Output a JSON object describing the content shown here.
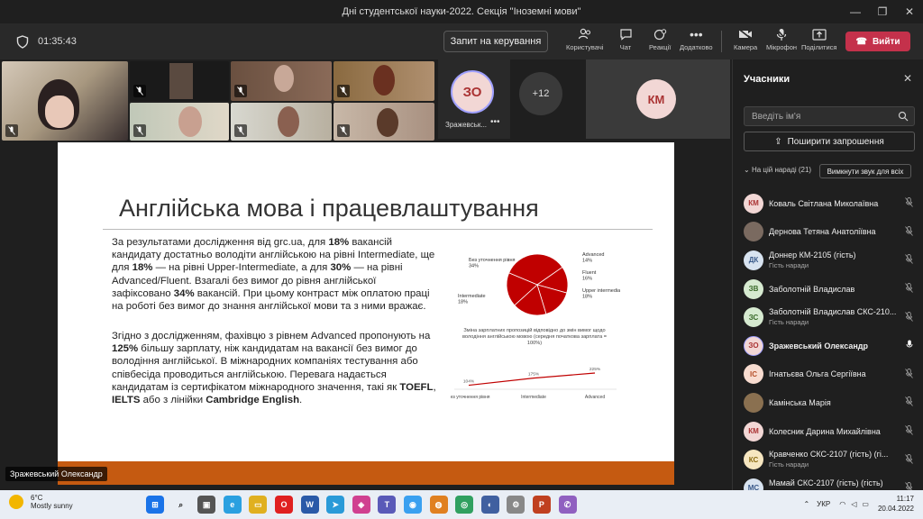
{
  "window": {
    "title": "Дні студентської науки-2022. Секція \"Іноземні мови\"",
    "controls": [
      "—",
      "❐",
      "✕"
    ]
  },
  "toolbar": {
    "timer": "01:35:43",
    "request_control": "Запит на керування",
    "buttons": [
      {
        "label": "Користувачі",
        "icon": "people-icon",
        "badge": "21"
      },
      {
        "label": "Чат",
        "icon": "chat-icon"
      },
      {
        "label": "Реакції",
        "icon": "reactions-icon"
      },
      {
        "label": "Додатково",
        "icon": "more-icon"
      },
      {
        "label": "Камера",
        "icon": "camera-off-icon"
      },
      {
        "label": "Мікрофон",
        "icon": "mic-off-icon"
      },
      {
        "label": "Поділитися",
        "icon": "share-icon"
      }
    ],
    "leave": "Вийти"
  },
  "videos": {
    "avatar_initials": "ЗО",
    "avatar_name": "Зражевськ...",
    "more_count": "+12",
    "km_initials": "КМ"
  },
  "slide": {
    "title": "Англійська мова і працевлаштування",
    "para1": "За результатами дослідження від grc.ua, для 18% вакансій кандидату достатньо володіти англійською на рівні Intermediate, ще для 18% — на рівні Upper-Intermediate, а для 30% — на рівні Advanced/Fluent. Взагалі без вимог до рівня англійської зафіксовано 34% вакансій. При цьому контраст між оплатою праці на роботі без вимог до знання англійської мови та з ними вражає.",
    "para2": "Згідно з дослідженням, фахівцю з рівнем Advanced пропонують на 125% більшу зарплату, ніж кандидатам на вакансії без вимог до володіння англійської. В міжнародних компаніях тестування або співбесіда проводиться англійською. Перевага надається кандидатам із сертифікатом міжнародного значення, такі як TOEFL, IELTS або з лінійки Cambridge English.",
    "line_chart_title": "Зміна зарплатних пропозицій відповідно до змін вимог щодо володіння англійською мовою (середня початкова зарплата = 100%)",
    "presenter_label": "Зражевський Олександр"
  },
  "chart_data": [
    {
      "type": "pie",
      "categories": [
        "Без уточнення рівня",
        "Advanced",
        "Fluent",
        "Upper intermediate",
        "Intermediate"
      ],
      "values": [
        34,
        14,
        16,
        18,
        18
      ],
      "labels": [
        "Без уточнення рівня\n34%",
        "Advanced\n14%",
        "Fluent\n16%",
        "Upper intermediate\n18%",
        "Intermediate\n18%"
      ],
      "color": "#c00000"
    },
    {
      "type": "line",
      "categories": [
        "Без уточнення рівня",
        "Intermediate",
        "Advanced"
      ],
      "values": [
        104,
        175,
        225
      ],
      "value_labels": [
        "104%",
        "175%",
        "225%"
      ],
      "color": "#c00000"
    }
  ],
  "panel": {
    "title": "Учасники",
    "search_placeholder": "Введіть ім'я",
    "share_invite": "Поширити запрошення",
    "in_meeting": "На цій нараді (21)",
    "mute_all": "Вимкнути звук для всіх",
    "participants": [
      {
        "initials": "КМ",
        "name": "Коваль Світлана Миколаївна",
        "sub": "",
        "color": "#f2d7d5",
        "fg": "#a33"
      },
      {
        "initials": "",
        "name": "Дернова Тетяна Анатоліївна",
        "sub": "",
        "color": "#7a6a60",
        "fg": "#fff"
      },
      {
        "initials": "ДК",
        "name": "Доннер КМ-2105 (гість)",
        "sub": "Гість наради",
        "color": "#d8e3f0",
        "fg": "#3a5a8a"
      },
      {
        "initials": "ЗВ",
        "name": "Заболотній Владислав",
        "sub": "",
        "color": "#d6ead0",
        "fg": "#3a6a2a"
      },
      {
        "initials": "ЗС",
        "name": "Заболотній Владислав СКС-210...",
        "sub": "Гість наради",
        "color": "#d6ead0",
        "fg": "#3a6a2a"
      },
      {
        "initials": "ЗО",
        "name": "Зражевський Олександр",
        "sub": "",
        "color": "#f2d7d5",
        "fg": "#a33"
      },
      {
        "initials": "ІС",
        "name": "Ігнатьєва Ольга Сергіївна",
        "sub": "",
        "color": "#f8dcd0",
        "fg": "#b5502a"
      },
      {
        "initials": "",
        "name": "Камінська Марія",
        "sub": "",
        "color": "#8a7050",
        "fg": "#fff"
      },
      {
        "initials": "КМ",
        "name": "Колесник Дарина Михайлівна",
        "sub": "",
        "color": "#f2d7d5",
        "fg": "#a33"
      },
      {
        "initials": "КС",
        "name": "Кравченко СКС-2107 (гість) (гі...",
        "sub": "Гість наради",
        "color": "#f6e6c0",
        "fg": "#8a6a10"
      },
      {
        "initials": "МС",
        "name": "Мамай СКС-2107 (гість) (гість)",
        "sub": "Гість наради",
        "color": "#d8e3f0",
        "fg": "#3a5a8a"
      }
    ]
  },
  "taskbar": {
    "temp": "6°C",
    "weather": "Mostly sunny",
    "lang": "УКР",
    "time": "11:17",
    "date": "20.04.2022"
  }
}
